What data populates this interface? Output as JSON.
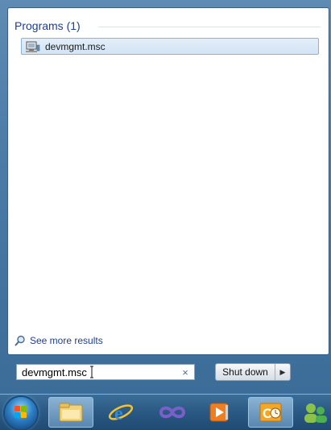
{
  "results": {
    "group_header": "Programs (1)",
    "item_label": "devmgmt.msc"
  },
  "footer": {
    "see_more": "See more results"
  },
  "search": {
    "value": "devmgmt.msc",
    "clear_glyph": "×"
  },
  "shutdown": {
    "label": "Shut down",
    "arrow_glyph": "▶"
  },
  "taskbar": {
    "items": [
      "start-orb",
      "explorer-icon",
      "internet-explorer-icon",
      "visual-studio-icon",
      "media-player-icon",
      "outlook-icon",
      "people-icon"
    ]
  }
}
